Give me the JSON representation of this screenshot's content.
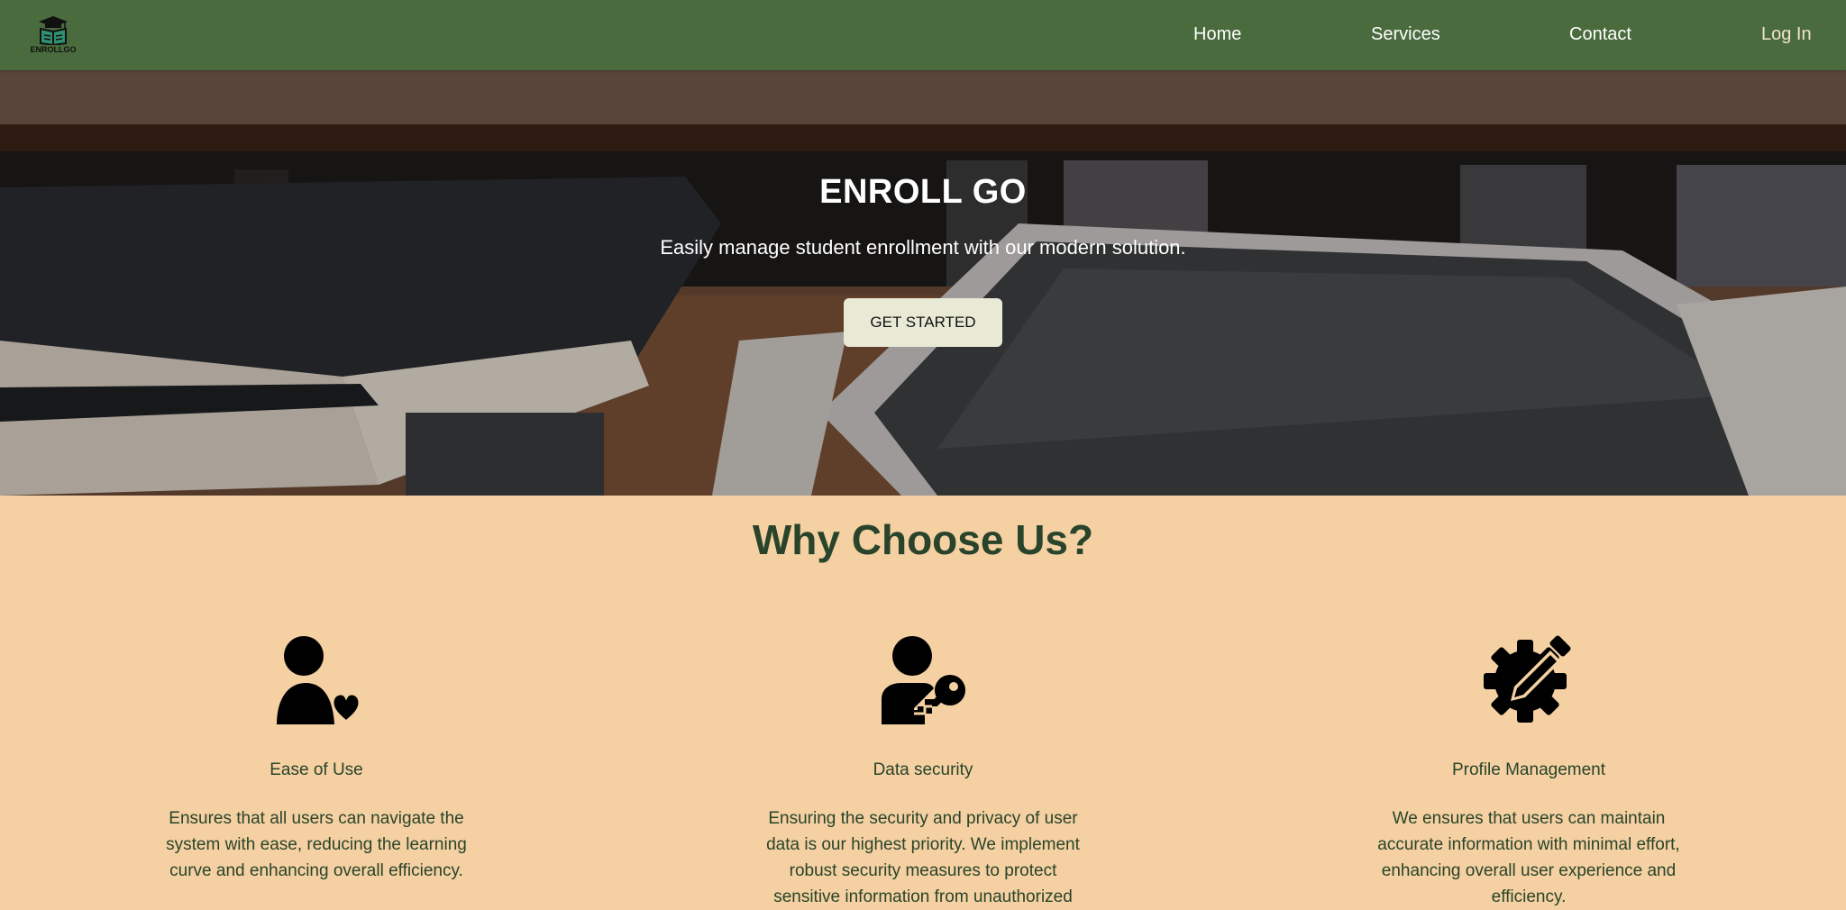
{
  "brand": {
    "logo_text": "ENROLLGO",
    "logo_icon": "graduation-cap-book-icon"
  },
  "nav": {
    "items": [
      {
        "label": "Home"
      },
      {
        "label": "Services"
      },
      {
        "label": "Contact"
      },
      {
        "label": "Log In"
      }
    ]
  },
  "hero": {
    "title": "ENROLL GO",
    "subtitle": "Easily manage student enrollment with our modern solution.",
    "cta_label": "GET STARTED"
  },
  "why": {
    "title": "Why Choose Us?",
    "features": [
      {
        "icon": "user-heart-icon",
        "title": "Ease of Use",
        "text": "Ensures that all users can navigate the system with ease, reducing the learning curve and enhancing overall efficiency."
      },
      {
        "icon": "user-key-icon",
        "title": "Data security",
        "text": "Ensuring the security and privacy of user data is our highest priority. We implement robust security measures to protect sensitive information from unauthorized"
      },
      {
        "icon": "gear-pencil-icon",
        "title": "Profile Management",
        "text": "We ensures that users can maintain accurate information with minimal effort, enhancing overall user experience and efficiency."
      }
    ]
  },
  "colors": {
    "nav_bg": "#4a6b3d",
    "section_bg": "#f4d0a2",
    "heading": "#29442a",
    "cta_bg": "#e8ead6"
  }
}
